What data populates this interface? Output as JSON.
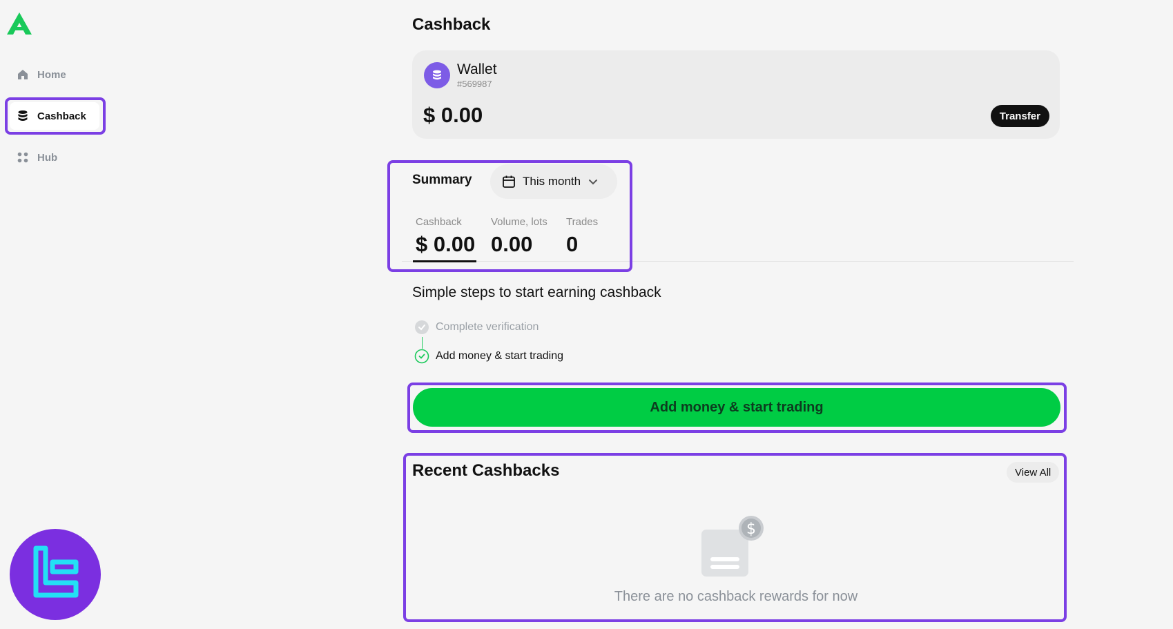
{
  "sidebar": {
    "logo_icon": "broker-logo-icon",
    "items": [
      {
        "label": "Home",
        "icon": "home-icon"
      },
      {
        "label": "Cashback",
        "icon": "database-stack-icon",
        "active": true
      },
      {
        "label": "Hub",
        "icon": "grid-dots-icon"
      }
    ]
  },
  "page": {
    "title": "Cashback"
  },
  "wallet": {
    "name": "Wallet",
    "id": "#569987",
    "balance": "$ 0.00",
    "transfer_label": "Transfer",
    "icon": "coin-stack-icon"
  },
  "summary": {
    "title": "Summary",
    "period": "This month",
    "stats": [
      {
        "label": "Cashback",
        "value": "$ 0.00"
      },
      {
        "label": "Volume, lots",
        "value": "0.00"
      },
      {
        "label": "Trades",
        "value": "0"
      }
    ]
  },
  "steps": {
    "title": "Simple steps to start earning cashback",
    "items": [
      {
        "label": "Complete verification",
        "completed": true
      },
      {
        "label": "Add money & start trading",
        "completed": false
      }
    ]
  },
  "cta": {
    "label": "Add money & start trading"
  },
  "recent": {
    "title": "Recent Cashbacks",
    "view_all_label": "View All",
    "empty_text": "There are no cashback rewards for now"
  },
  "colors": {
    "accent_green": "#00cc44",
    "highlight_purple": "#7b3fe4",
    "wallet_purple": "#7d5ce6"
  }
}
